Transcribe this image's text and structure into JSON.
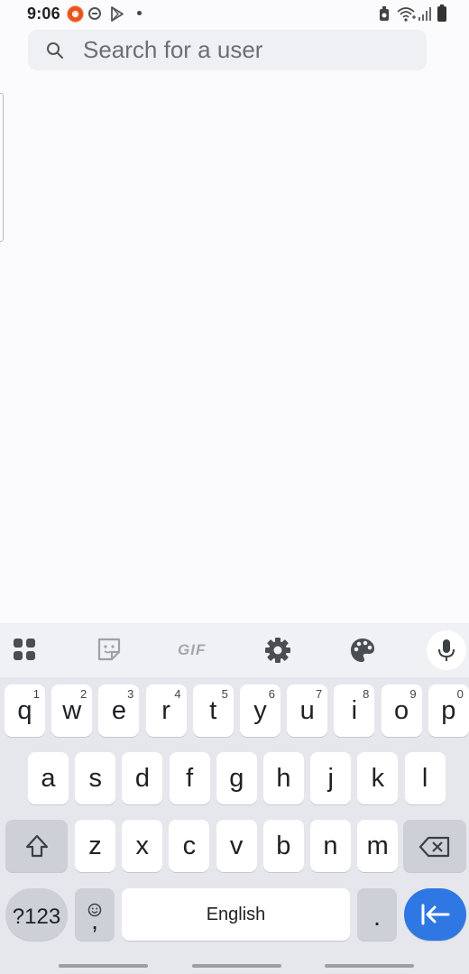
{
  "status_bar": {
    "time": "9:06",
    "left_icons": [
      "app-badge-icon",
      "do-not-disturb-icon",
      "play-store-icon",
      "dot-icon"
    ],
    "right_icons": [
      "alarm-icon",
      "wifi-icon",
      "signal-icon",
      "battery-icon"
    ]
  },
  "search": {
    "placeholder": "Search for a user",
    "value": ""
  },
  "keyboard": {
    "toolbar": [
      "apps-grid-icon",
      "sticker-icon",
      "gif-icon",
      "settings-icon",
      "palette-icon",
      "mic-icon"
    ],
    "gif_label": "GIF",
    "row1": [
      {
        "key": "q",
        "hint": "1"
      },
      {
        "key": "w",
        "hint": "2"
      },
      {
        "key": "e",
        "hint": "3"
      },
      {
        "key": "r",
        "hint": "4"
      },
      {
        "key": "t",
        "hint": "5"
      },
      {
        "key": "y",
        "hint": "6"
      },
      {
        "key": "u",
        "hint": "7"
      },
      {
        "key": "i",
        "hint": "8"
      },
      {
        "key": "o",
        "hint": "9"
      },
      {
        "key": "p",
        "hint": "0"
      }
    ],
    "row2": [
      "a",
      "s",
      "d",
      "f",
      "g",
      "h",
      "j",
      "k",
      "l"
    ],
    "row3": [
      "z",
      "x",
      "c",
      "v",
      "b",
      "n",
      "m"
    ],
    "symbols_label": "?123",
    "comma_label": ",",
    "space_label": "English",
    "period_label": ".",
    "accent_color": "#2f78e3"
  }
}
